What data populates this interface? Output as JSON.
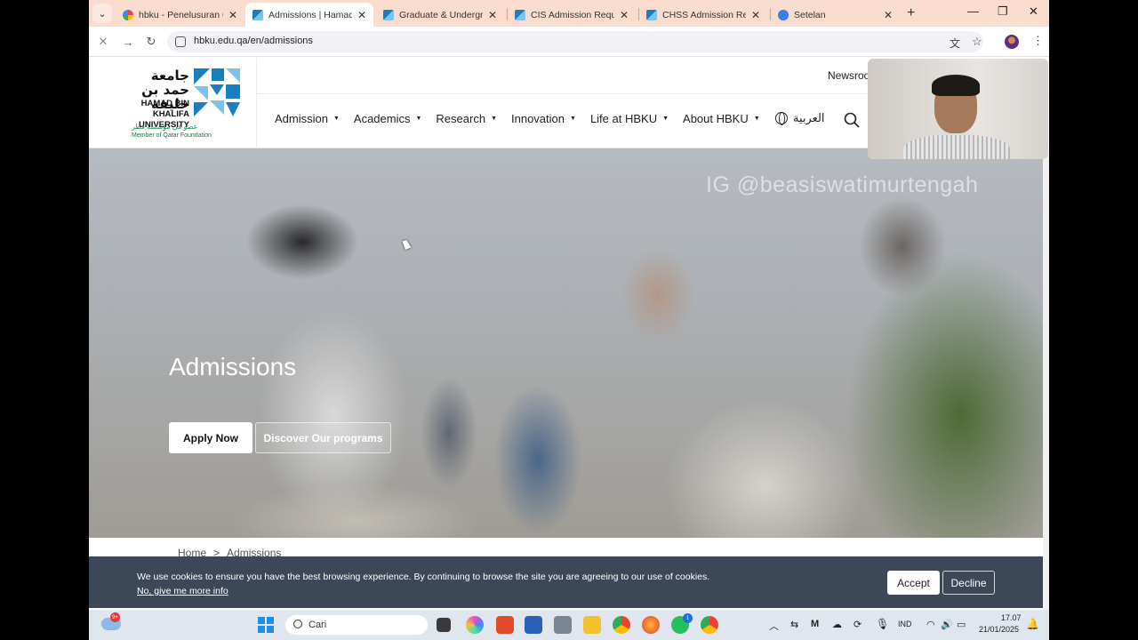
{
  "browser": {
    "tabs": [
      {
        "title": "hbku - Penelusuran Go",
        "favicon": "google-icon",
        "active": false
      },
      {
        "title": "Admissions | Hamad Bi",
        "favicon": "hbku-icon",
        "active": true
      },
      {
        "title": "Graduate & Undergrad",
        "favicon": "hbku-icon",
        "active": false
      },
      {
        "title": "CIS Admission Requirem",
        "favicon": "hbku-icon",
        "active": false
      },
      {
        "title": "CHSS Admission Requir",
        "favicon": "hbku-icon",
        "active": false
      },
      {
        "title": "Setelan",
        "favicon": "gear-icon",
        "active": false
      }
    ],
    "url": "hbku.edu.qa/en/admissions"
  },
  "site": {
    "logo": {
      "arabic_line1": "جامعة",
      "arabic_line2": "حمد بن خليفة",
      "english_line1": "HAMAD BIN KHALIFA",
      "english_line2": "UNIVERSITY",
      "qf_arabic": "عضو في مؤسسة قطر",
      "qf_english": "Member of Qatar Foundation"
    },
    "utility": {
      "newsroom": "Newsroo"
    },
    "nav": [
      "Admission",
      "Academics",
      "Research",
      "Innovation",
      "Life at HBKU",
      "About HBKU"
    ],
    "language": "العربية"
  },
  "hero": {
    "title": "Admissions",
    "apply_label": "Apply Now",
    "discover_label": "Discover Our programs",
    "watermark": "IG @beasiswatimurtengah"
  },
  "breadcrumb": [
    "Home",
    ">",
    "Admissions"
  ],
  "cookie": {
    "message": "We use cookies to ensure you have the best browsing experience. By continuing to browse the site you are agreeing to our use of cookies.",
    "more_info": "No, give me more info",
    "accept": "Accept",
    "decline": "Decline"
  },
  "taskbar": {
    "search_placeholder": "Cari",
    "weather_badge": "9+",
    "whatsapp_badge": "1",
    "language": "IND",
    "time": "17.07",
    "date": "21/01/2025"
  },
  "colors": {
    "tabstrip": "#f9dccd",
    "cookie_bar": "#343f50",
    "taskbar": "#dfe6ee",
    "logo_blue": "#1a7fc1",
    "logo_green": "#1f8f5a"
  }
}
